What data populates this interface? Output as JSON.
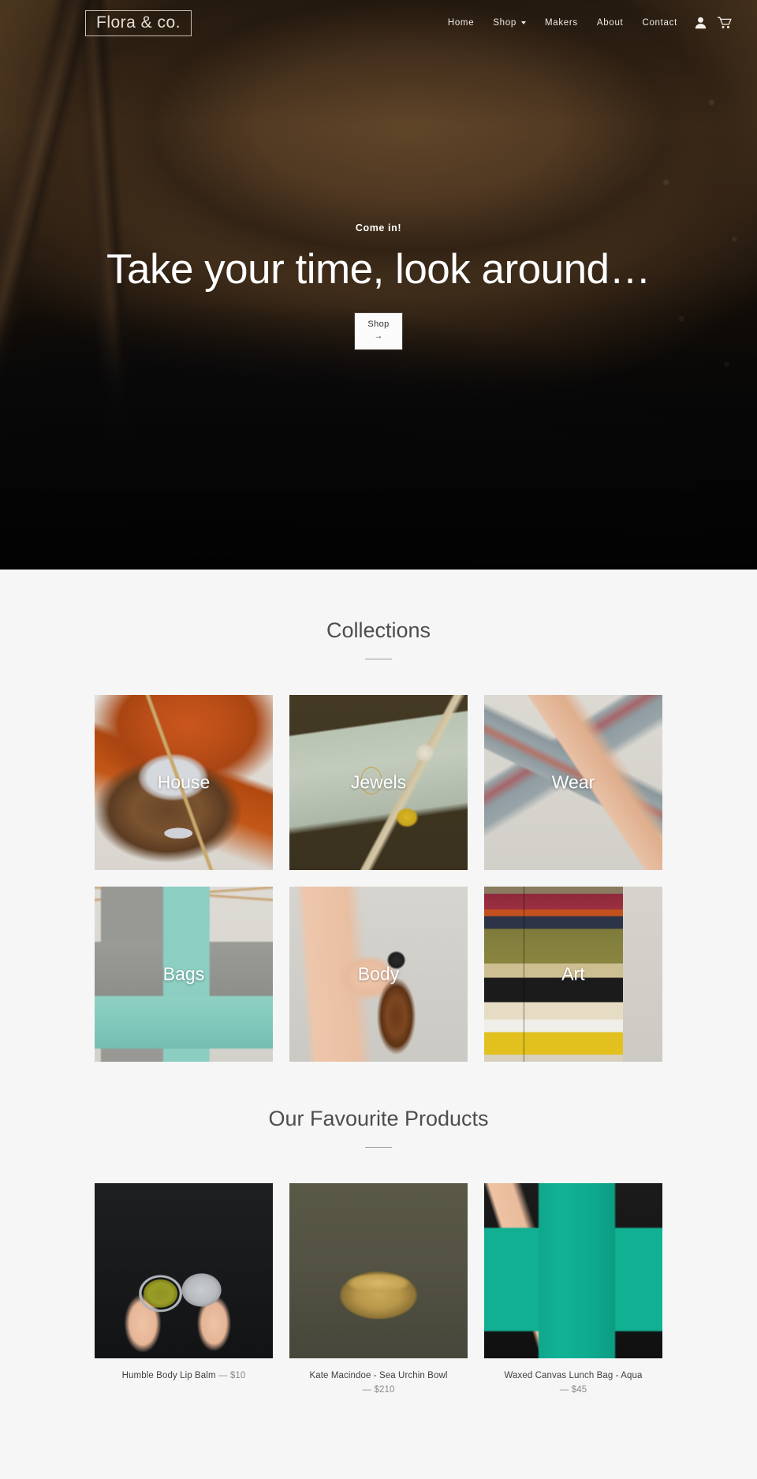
{
  "brand": {
    "logo_text": "Flora & co."
  },
  "nav": {
    "items": [
      {
        "label": "Home",
        "has_dropdown": false
      },
      {
        "label": "Shop",
        "has_dropdown": true
      },
      {
        "label": "Makers",
        "has_dropdown": false
      },
      {
        "label": "About",
        "has_dropdown": false
      },
      {
        "label": "Contact",
        "has_dropdown": false
      }
    ],
    "icons": [
      {
        "name": "account-icon",
        "label": "Account"
      },
      {
        "name": "cart-icon",
        "label": "Cart"
      }
    ]
  },
  "hero": {
    "kicker": "Come in!",
    "title": "Take your time, look around…",
    "button_label": "Shop",
    "button_arrow": "→"
  },
  "collections": {
    "title": "Collections",
    "items": [
      {
        "label": "House"
      },
      {
        "label": "Jewels"
      },
      {
        "label": "Wear"
      },
      {
        "label": "Bags"
      },
      {
        "label": "Body"
      },
      {
        "label": "Art"
      }
    ]
  },
  "products": {
    "title": "Our Favourite Products",
    "items": [
      {
        "name": "Humble Body Lip Balm",
        "dash": "—",
        "price": "$10"
      },
      {
        "name": "Kate Macindoe - Sea Urchin Bowl",
        "dash": "—",
        "price": "$210"
      },
      {
        "name": "Waxed Canvas Lunch Bag - Aqua",
        "dash": "—",
        "price": "$45"
      }
    ]
  },
  "colors": {
    "page_bg": "#f6f6f6",
    "hero_overlay": "#100d0a",
    "logo_border": "#cbbfae",
    "heading": "#4d4d4d",
    "price": "#8a8a8a",
    "button_bg": "#fbfbfb"
  }
}
